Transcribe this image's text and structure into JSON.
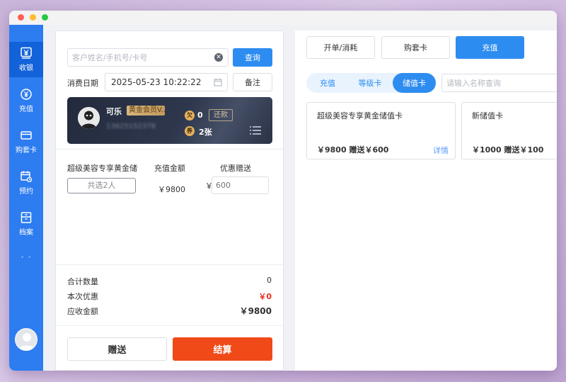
{
  "sidebar": {
    "items": [
      {
        "label": "收银",
        "icon": "cashier-icon"
      },
      {
        "label": "充值",
        "icon": "recharge-icon"
      },
      {
        "label": "购套卡",
        "icon": "card-icon"
      },
      {
        "label": "预约",
        "icon": "calendar-icon"
      },
      {
        "label": "档案",
        "icon": "archive-icon"
      }
    ],
    "more": "- -"
  },
  "left": {
    "search_placeholder": "客户姓名/手机号/卡号",
    "search_button": "查询",
    "date_label": "消费日期",
    "date_value": "2025-05-23 10:22:22",
    "note_button": "备注",
    "member": {
      "name": "可乐",
      "level": "黄金会员V...",
      "phone": "13625152378",
      "debt_icon": "欠",
      "debt_count": "0",
      "repay": "还款",
      "coupon_icon": "券",
      "coupon_count": "2张"
    },
    "columns": {
      "name": "超级美容专享黄金储值卡",
      "amount": "充值金额",
      "gift": "优惠赠送"
    },
    "row": {
      "selector": "共选2人",
      "amount": "￥9800",
      "gift_prefix": "￥",
      "gift_value": "600"
    },
    "summary": {
      "count_label": "合计数量",
      "count_value": "0",
      "discount_label": "本次优惠",
      "discount_value": "￥0",
      "due_label": "应收金额",
      "due_value": "￥9800"
    },
    "gift_button": "赠送",
    "checkout_button": "结算"
  },
  "right": {
    "tabs": [
      "开单/消耗",
      "购套卡",
      "充值"
    ],
    "pills": [
      "充值",
      "等级卡",
      "储值卡"
    ],
    "name_search_placeholder": "请输入名称查询",
    "cards": [
      {
        "title": "超级美容专享黄金储值卡",
        "price": "￥9800 赠送￥600",
        "detail": "详情"
      },
      {
        "title": "新储值卡",
        "price": "￥1000 赠送￥100"
      }
    ]
  },
  "colors": {
    "primary": "#2d8cf0",
    "sidebar": "#2d7cf0",
    "checkout": "#f04a18",
    "discount": "#e62e1e"
  }
}
